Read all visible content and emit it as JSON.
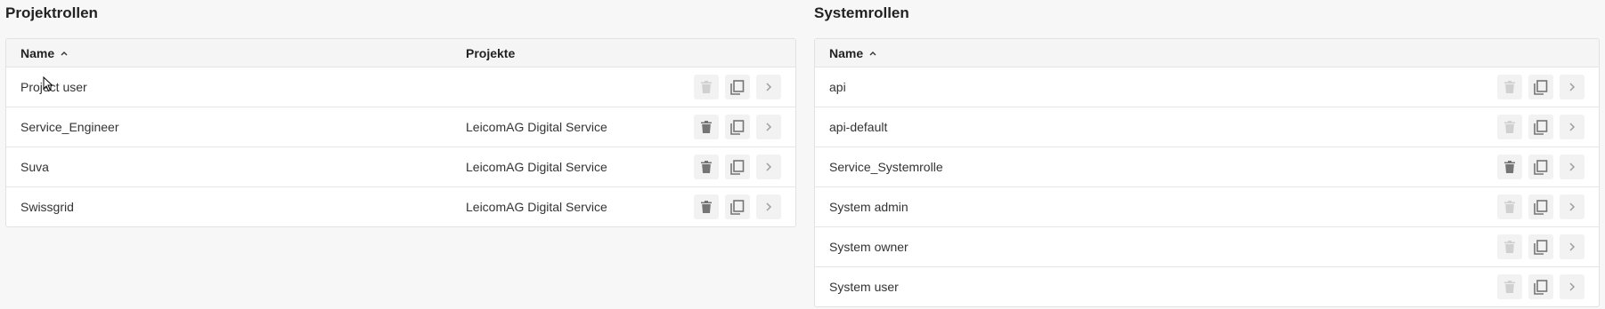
{
  "project_roles": {
    "title": "Projektrollen",
    "columns": {
      "name": "Name",
      "projects": "Projekte"
    },
    "rows": [
      {
        "name": "Project user",
        "project": "",
        "delete_enabled": false
      },
      {
        "name": "Service_Engineer",
        "project": "LeicomAG Digital Service",
        "delete_enabled": true
      },
      {
        "name": "Suva",
        "project": "LeicomAG Digital Service",
        "delete_enabled": true
      },
      {
        "name": "Swissgrid",
        "project": "LeicomAG Digital Service",
        "delete_enabled": true
      }
    ]
  },
  "system_roles": {
    "title": "Systemrollen",
    "columns": {
      "name": "Name"
    },
    "rows": [
      {
        "name": "api",
        "delete_enabled": false
      },
      {
        "name": "api-default",
        "delete_enabled": false
      },
      {
        "name": "Service_Systemrolle",
        "delete_enabled": true
      },
      {
        "name": "System admin",
        "delete_enabled": false
      },
      {
        "name": "System owner",
        "delete_enabled": false
      },
      {
        "name": "System user",
        "delete_enabled": false
      }
    ]
  },
  "icons": {
    "sort": "chevron-up-icon",
    "delete": "trash-icon",
    "copy": "copy-icon",
    "open": "chevron-right-icon"
  },
  "colors": {
    "icon_enabled": "#757575",
    "icon_disabled": "#d0d0d0"
  }
}
